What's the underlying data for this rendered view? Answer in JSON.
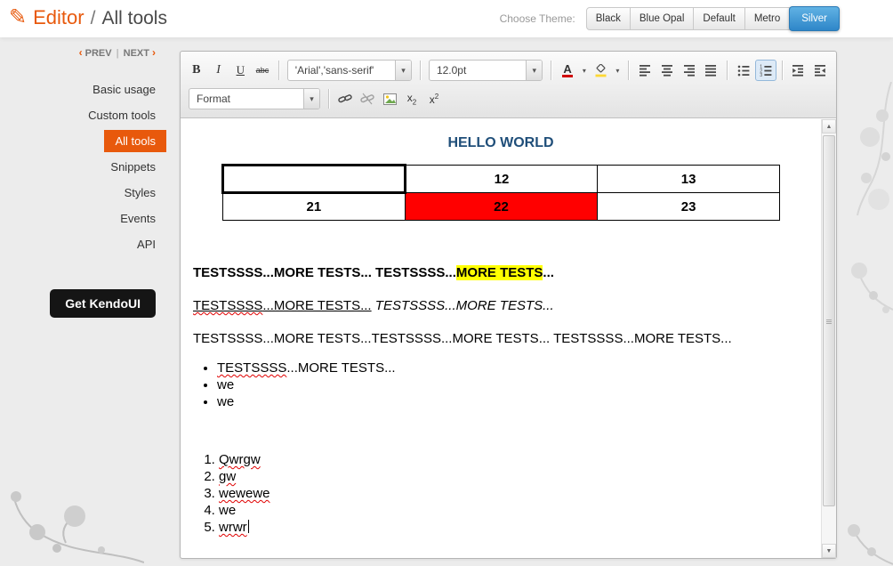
{
  "header": {
    "app_title": "Editor",
    "separator": "/",
    "page_title": "All tools",
    "theme_label": "Choose Theme:",
    "themes": [
      {
        "label": "Black"
      },
      {
        "label": "Blue Opal"
      },
      {
        "label": "Default"
      },
      {
        "label": "Metro"
      },
      {
        "label": "Silver"
      }
    ]
  },
  "icons": {
    "pencil": "✎",
    "dropdown_arrow": "▾",
    "scroll_up": "▲",
    "scroll_down": "▼"
  },
  "sidebar": {
    "prev_arrow": "‹",
    "prev": "PREV",
    "divider": "|",
    "next": "NEXT",
    "next_arrow": "›",
    "items": [
      {
        "label": "Basic usage"
      },
      {
        "label": "Custom tools"
      },
      {
        "label": "All tools"
      },
      {
        "label": "Snippets"
      },
      {
        "label": "Styles"
      },
      {
        "label": "Events"
      },
      {
        "label": "API"
      }
    ],
    "cta": "Get KendoUI"
  },
  "toolbar": {
    "bold": "B",
    "italic": "I",
    "underline": "U",
    "strike": "abc",
    "font_family_value": "'Arial','sans-serif'",
    "font_size_value": "12.0pt",
    "font_color_letter": "A",
    "format_value": "Format",
    "sub_base": "x",
    "sub_small": "2",
    "sup_base": "x",
    "sup_small": "2"
  },
  "editor": {
    "heading": "HELLO WORLD",
    "table": {
      "row1": [
        "",
        "12",
        "13"
      ],
      "row2": [
        "21",
        "22",
        "23"
      ]
    },
    "p1": {
      "lead": "TESTSSSS...MORE TESTS... TESTSSSS...",
      "highlight": "MORE TESTS",
      "tail": "..."
    },
    "p2": {
      "u_word": "TESTSSSS",
      "u_rest": "...MORE TESTS...",
      "italic": " TESTSSSS...MORE TESTS..."
    },
    "p3": "TESTSSSS...MORE TESTS...TESTSSSS...MORE TESTS... TESTSSSS...MORE TESTS...",
    "ul": {
      "first_word": "TESTSSSS",
      "first_rest": "...MORE TESTS...",
      "rest": [
        "we",
        "we"
      ]
    },
    "ol": [
      "Qwrgw",
      "gw",
      "wewewe",
      "we",
      "wrwr"
    ]
  },
  "colors": {
    "accent_orange": "#e8590c",
    "theme_selected_blue": "#2e86c8",
    "heading_blue": "#1f4e79",
    "table_cell_red": "#ff0000",
    "highlight_yellow": "#ffff00"
  }
}
